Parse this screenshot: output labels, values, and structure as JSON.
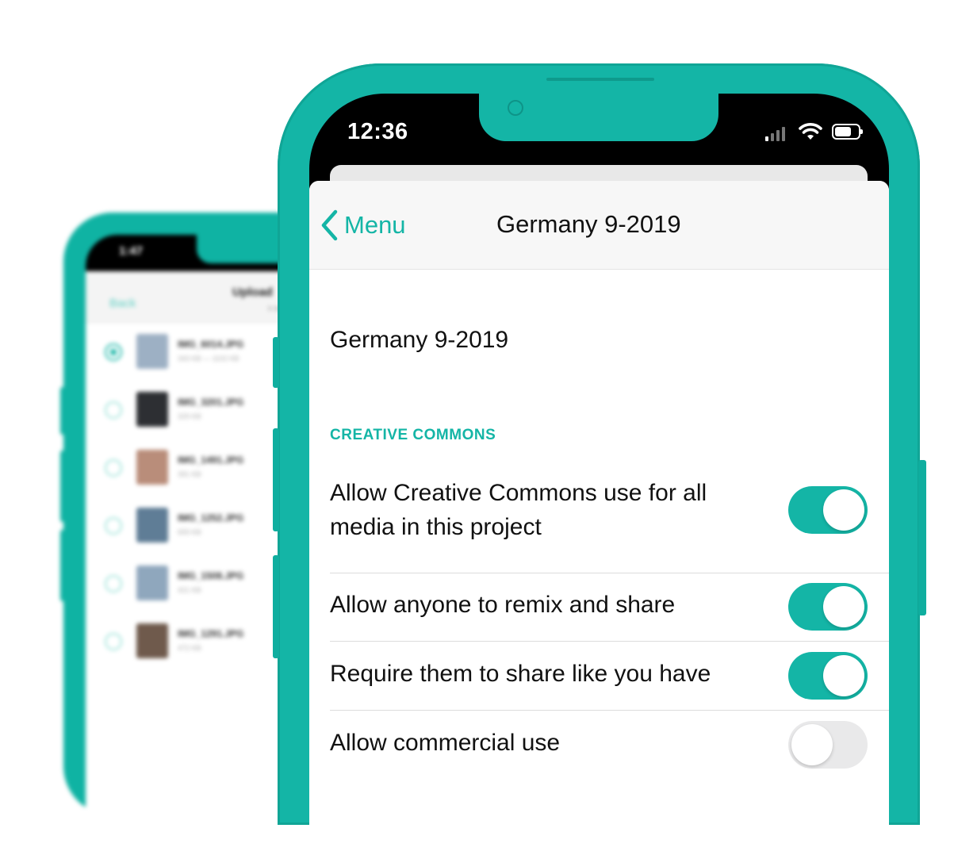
{
  "back_phone": {
    "status_time": "1:47",
    "nav": {
      "back_label": "Back",
      "title": "Upload",
      "subtitle": "6 items"
    },
    "files": [
      {
        "name": "IMG_6014.JPG",
        "size": "343 KB — 1102 KB",
        "selected": true,
        "thumb": "#9db0c4"
      },
      {
        "name": "IMG_3201.JPG",
        "size": "329 KB",
        "selected": false,
        "thumb": "#2d2f33"
      },
      {
        "name": "IMG_1491.JPG",
        "size": "391 KB",
        "selected": false,
        "thumb": "#b98d7a"
      },
      {
        "name": "IMG_1252.JPG",
        "size": "659 KB",
        "selected": false,
        "thumb": "#5f7d96"
      },
      {
        "name": "IMG_1508.JPG",
        "size": "421 KB",
        "selected": false,
        "thumb": "#8fa7bd"
      },
      {
        "name": "IMG_1291.JPG",
        "size": "472 KB",
        "selected": false,
        "thumb": "#6f5a4c"
      }
    ]
  },
  "front_phone": {
    "status_time": "12:36",
    "nav": {
      "back_label": "Menu",
      "title": "Germany 9-2019"
    },
    "project_name": "Germany 9-2019",
    "section_header": "CREATIVE COMMONS",
    "settings": [
      {
        "label_line1": "Allow Creative Commons use for all",
        "label_line2": "media in this project",
        "on": true
      },
      {
        "label_line1": "Allow anyone to remix and share",
        "on": true
      },
      {
        "label_line1": "Require them to share like you have",
        "on": true
      },
      {
        "label_line1": "Allow commercial use",
        "on": false
      }
    ]
  },
  "colors": {
    "accent": "#14b5a6",
    "toggle_off": "#e9e9ea"
  },
  "icons": [
    "chevron-left-icon",
    "signal-icon",
    "wifi-icon",
    "battery-icon",
    "camera-icon"
  ]
}
